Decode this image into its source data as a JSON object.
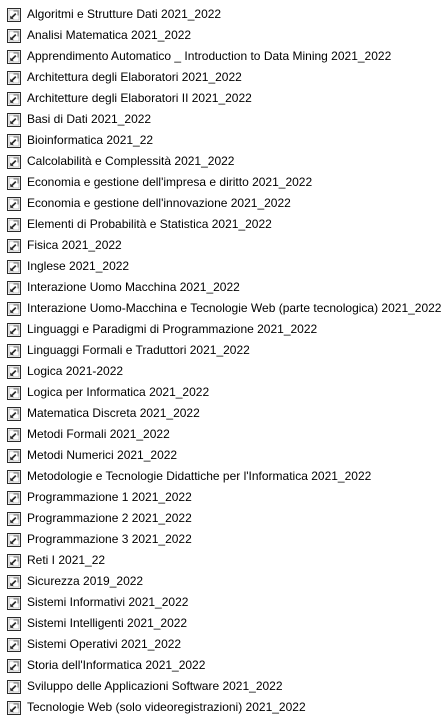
{
  "icon": "internet-shortcut-icon",
  "colors": {
    "icon_frame": "#2b2b2b",
    "icon_bg": "#ffffff",
    "icon_accent": "#7a7a7a"
  },
  "files": [
    {
      "name": "Algoritmi e Strutture Dati 2021_2022"
    },
    {
      "name": "Analisi Matematica 2021_2022"
    },
    {
      "name": "Apprendimento Automatico _ Introduction to Data Mining 2021_2022"
    },
    {
      "name": "Architettura degli Elaboratori 2021_2022"
    },
    {
      "name": "Architetture degli Elaboratori II 2021_2022"
    },
    {
      "name": "Basi di Dati 2021_2022"
    },
    {
      "name": "Bioinformatica 2021_22"
    },
    {
      "name": "Calcolabilità e Complessità 2021_2022"
    },
    {
      "name": "Economia e gestione dell'impresa e diritto 2021_2022"
    },
    {
      "name": "Economia e gestione dell'innovazione 2021_2022"
    },
    {
      "name": "Elementi di Probabilità e Statistica 2021_2022"
    },
    {
      "name": "Fisica 2021_2022"
    },
    {
      "name": "Inglese 2021_2022"
    },
    {
      "name": "Interazione Uomo Macchina 2021_2022"
    },
    {
      "name": "Interazione Uomo-Macchina e Tecnologie Web (parte tecnologica) 2021_2022"
    },
    {
      "name": "Linguaggi e Paradigmi di Programmazione 2021_2022"
    },
    {
      "name": "Linguaggi Formali e Traduttori 2021_2022"
    },
    {
      "name": "Logica 2021-2022"
    },
    {
      "name": "Logica per Informatica 2021_2022"
    },
    {
      "name": "Matematica Discreta 2021_2022"
    },
    {
      "name": "Metodi Formali 2021_2022"
    },
    {
      "name": "Metodi Numerici 2021_2022"
    },
    {
      "name": "Metodologie e Tecnologie Didattiche per l'Informatica 2021_2022"
    },
    {
      "name": "Programmazione 1 2021_2022"
    },
    {
      "name": "Programmazione 2 2021_2022"
    },
    {
      "name": "Programmazione 3 2021_2022"
    },
    {
      "name": "Reti I 2021_22"
    },
    {
      "name": "Sicurezza 2019_2022"
    },
    {
      "name": "Sistemi Informativi 2021_2022"
    },
    {
      "name": "Sistemi Intelligenti 2021_2022"
    },
    {
      "name": "Sistemi Operativi 2021_2022"
    },
    {
      "name": "Storia dell'Informatica 2021_2022"
    },
    {
      "name": "Sviluppo delle Applicazioni Software 2021_2022"
    },
    {
      "name": "Tecnologie Web (solo videoregistrazioni) 2021_2022"
    }
  ]
}
